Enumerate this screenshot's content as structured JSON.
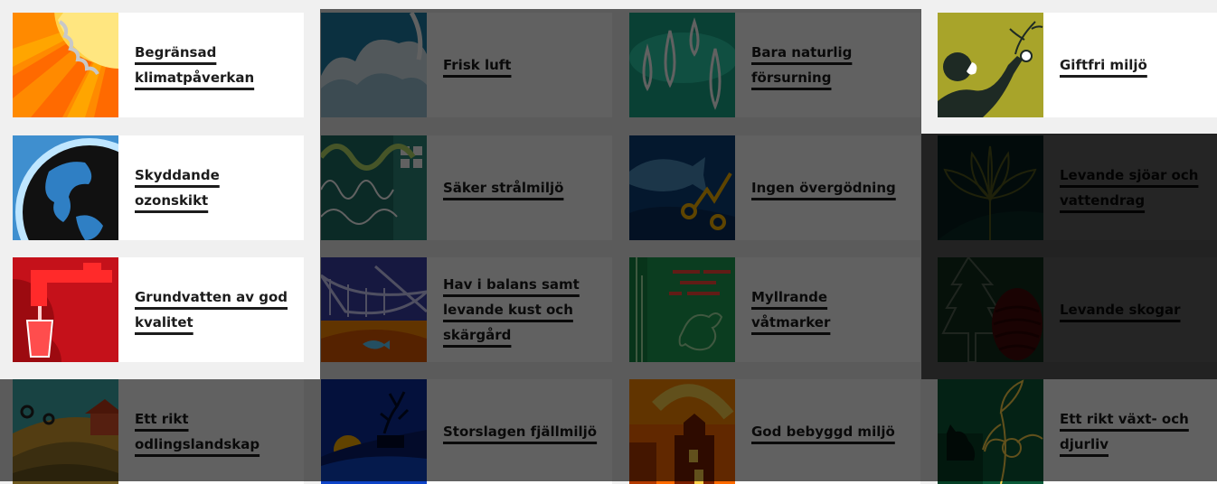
{
  "colors": {
    "page_background": "#f0f0f0",
    "overlay": "rgba(0,0,0,0.62)",
    "card_background": "#ffffff",
    "title_text": "#1c1c1c"
  },
  "goals": [
    {
      "id": "begransad-klimatpaverkan",
      "title": "Begränsad klimatpåverkan",
      "icon": "sun-icon",
      "highlighted": true
    },
    {
      "id": "frisk-luft",
      "title": "Frisk luft",
      "icon": "cloud-icon",
      "highlighted": false
    },
    {
      "id": "bara-naturlig-forsurning",
      "title": "Bara naturlig försurning",
      "icon": "raindrops-icon",
      "highlighted": false
    },
    {
      "id": "giftfri-miljo",
      "title": "Giftfri miljö",
      "icon": "person-reaching-icon",
      "highlighted": true
    },
    {
      "id": "skyddande-ozonskikt",
      "title": "Skyddande ozonskikt",
      "icon": "globe-icon",
      "highlighted": true
    },
    {
      "id": "saker-stralmiljo",
      "title": "Säker strålmiljö",
      "icon": "waves-window-icon",
      "highlighted": false
    },
    {
      "id": "ingen-overgodning",
      "title": "Ingen övergödning",
      "icon": "fish-molecule-icon",
      "highlighted": false
    },
    {
      "id": "levande-sjoar-och-vattendrag",
      "title": "Levande sjöar och vattendrag",
      "icon": "water-lily-icon",
      "highlighted": false
    },
    {
      "id": "grundvatten-av-god-kvalitet",
      "title": "Grundvatten av god kvalitet",
      "icon": "tap-glass-icon",
      "highlighted": true
    },
    {
      "id": "hav-i-balans",
      "title": "Hav i balans samt levande kust och skärgård",
      "icon": "boat-fish-icon",
      "highlighted": false
    },
    {
      "id": "myllrande-vatmarker",
      "title": "Myllrande våtmarker",
      "icon": "frog-icon",
      "highlighted": false
    },
    {
      "id": "levande-skogar",
      "title": "Levande skogar",
      "icon": "spruce-cone-icon",
      "highlighted": false
    },
    {
      "id": "ett-rikt-odlingslandskap",
      "title": "Ett rikt odlingslandskap",
      "icon": "farm-landscape-icon",
      "highlighted": false
    },
    {
      "id": "storslagen-fjallmiljo",
      "title": "Storslagen fjällmiljö",
      "icon": "reindeer-icon",
      "highlighted": false
    },
    {
      "id": "god-bebyggd-miljo",
      "title": "God bebyggd miljö",
      "icon": "buildings-icon",
      "highlighted": false
    },
    {
      "id": "ett-rikt-vaxt-och-djurliv",
      "title": "Ett rikt växt- och djurliv",
      "icon": "cat-orchid-icon",
      "highlighted": false
    }
  ]
}
